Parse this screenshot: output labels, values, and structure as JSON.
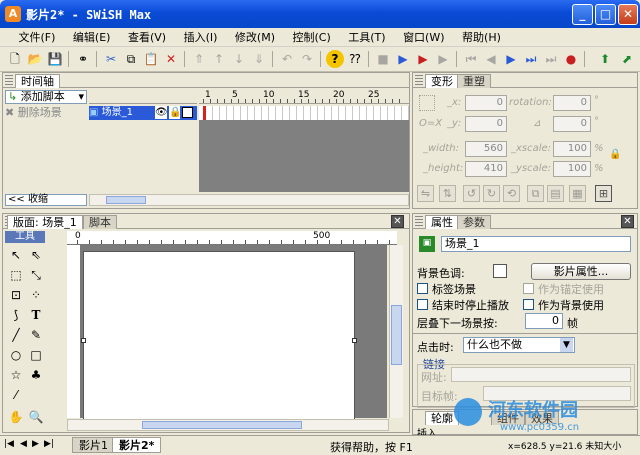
{
  "window": {
    "title": "影片2* - SWiSH Max",
    "app_icon_glyph": "A",
    "min": "_",
    "max": "□",
    "close": "✕"
  },
  "menu": [
    "文件(F)",
    "编辑(E)",
    "查看(V)",
    "插入(I)",
    "修改(M)",
    "控制(C)",
    "工具(T)",
    "窗口(W)",
    "帮助(H)"
  ],
  "timeline": {
    "tab": "时间轴",
    "add_script": "添加脚本",
    "delete_scene": "删除场景",
    "scene_name": "场景_1",
    "frame_ticks": [
      "1",
      "5",
      "10",
      "15",
      "20",
      "25"
    ],
    "collapse": "收缩",
    "collapse_arrows": "<<"
  },
  "transform": {
    "tabs": [
      "变形",
      "重塑"
    ],
    "x_label": "_x:",
    "y_label": "_y:",
    "x_value": "0",
    "y_value": "0",
    "rotation_label": "rotation:",
    "rotation_value": "0",
    "rotation_unit": "°",
    "skew_value": "0",
    "skew_unit": "°",
    "width_label": "_width:",
    "width_value": "560",
    "xscale_label": "_xscale:",
    "xscale_value": "100",
    "xscale_unit": "%",
    "height_label": "_height:",
    "height_value": "410",
    "yscale_label": "_yscale:",
    "yscale_value": "100",
    "yscale_unit": "%",
    "origin_label": "O=X"
  },
  "stage": {
    "tabs": [
      "版面: 场景_1",
      "脚本"
    ],
    "tools_title": "工具",
    "ruler_ticks": [
      "0",
      "500"
    ]
  },
  "properties": {
    "tabs": [
      "属性",
      "参数"
    ],
    "scene_name": "场景_1",
    "bg_color_label": "背景色调:",
    "movie_props_button": "影片属性...",
    "label_scene": "标签场景",
    "as_anchor": "作为锚定使用",
    "stop_at_end": "结束时停止播放",
    "as_background": "作为背景使用",
    "stack_label": "层叠下一场景按:",
    "stack_value": "0",
    "stack_unit": "帧",
    "on_click_label": "点击时:",
    "on_click_value": "什么也不做",
    "link_group": "链接",
    "url_label": "网址:",
    "target_label": "目标帧:",
    "bottom_tabs": [
      "轮廓",
      "组件",
      "效果"
    ],
    "insert_label": "插入"
  },
  "statusbar": {
    "movie_tabs": [
      "影片1",
      "影片2*"
    ],
    "help_text": "获得帮助，按 F1",
    "coords": "x=628.5 y=21.6  未知大小"
  },
  "watermark": {
    "name": "河东软件园",
    "url": "www.pc0359.cn"
  }
}
